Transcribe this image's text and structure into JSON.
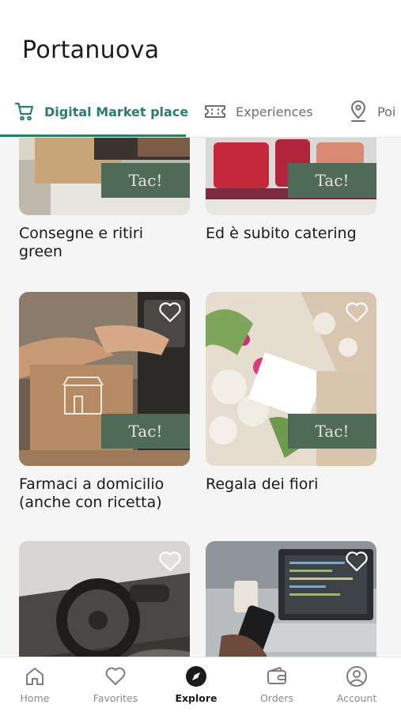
{
  "header": {
    "title": "Portanuova"
  },
  "tabs": [
    {
      "label": "Digital Market place",
      "icon": "cart-icon",
      "active": true
    },
    {
      "label": "Experiences",
      "icon": "ticket-icon",
      "active": false
    },
    {
      "label": "Poi",
      "icon": "location-pin-icon",
      "active": false
    }
  ],
  "colors": {
    "accent": "#2a7d6c",
    "badge": "#4f6b58"
  },
  "cards": [
    {
      "title": "Consegne e ritiri green",
      "badge": "Tac!",
      "favorite_visible": false
    },
    {
      "title": "Ed è subito catering",
      "badge": "Tac!",
      "favorite_visible": false
    },
    {
      "title": "Farmaci a domicilio (anche con ricetta)",
      "badge": "Tac!",
      "favorite_visible": true
    },
    {
      "title": "Regala dei fiori",
      "badge": "Tac!",
      "favorite_visible": true
    },
    {
      "title": "",
      "badge": "",
      "favorite_visible": true
    },
    {
      "title": "",
      "badge": "",
      "favorite_visible": true
    }
  ],
  "bottom_nav": [
    {
      "label": "Home",
      "icon": "home-icon",
      "active": false
    },
    {
      "label": "Favorites",
      "icon": "heart-icon",
      "active": false
    },
    {
      "label": "Explore",
      "icon": "compass-icon",
      "active": true
    },
    {
      "label": "Orders",
      "icon": "wallet-icon",
      "active": false
    },
    {
      "label": "Account",
      "icon": "account-icon",
      "active": false
    }
  ]
}
